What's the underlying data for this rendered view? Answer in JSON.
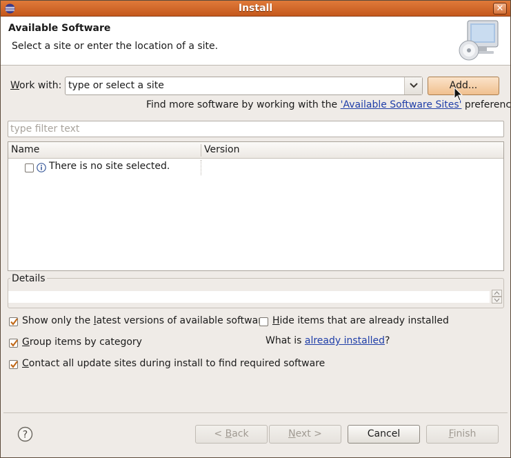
{
  "window": {
    "title": "Install"
  },
  "header": {
    "title": "Available Software",
    "description": "Select a site or enter the location of a site."
  },
  "work_with": {
    "label_accel": "W",
    "label_rest": "ork with:",
    "value": "type or select a site",
    "add_button": "Add..."
  },
  "more_software": {
    "prefix": "Find more software by working with the ",
    "link": "'Available Software Sites'",
    "suffix": " preferences."
  },
  "filter": {
    "placeholder": "type filter text"
  },
  "table": {
    "columns": [
      "Name",
      "Version"
    ],
    "rows": [
      {
        "name": "There is no site selected.",
        "version": ""
      }
    ]
  },
  "details": {
    "label": "Details",
    "text": ""
  },
  "options": {
    "latest_pre": "Show only the ",
    "latest_accel": "l",
    "latest_post": "atest versions of available software",
    "hide_accel": "H",
    "hide_post": "ide items that are already installed",
    "group_accel": "G",
    "group_post": "roup items by category",
    "contact_accel": "C",
    "contact_post": "ontact all update sites during install to find required software",
    "what_is": "What is ",
    "already_installed": "already installed",
    "qmark": "?"
  },
  "buttons": {
    "back_pre": "< ",
    "back_accel": "B",
    "back_post": "ack",
    "next_accel": "N",
    "next_post": "ext >",
    "cancel": "Cancel",
    "finish_accel": "F",
    "finish_post": "inish"
  },
  "colors": {
    "title_bar": "#d0622a",
    "link": "#1f3ea8",
    "checkbox_check": "#c26a1a"
  }
}
